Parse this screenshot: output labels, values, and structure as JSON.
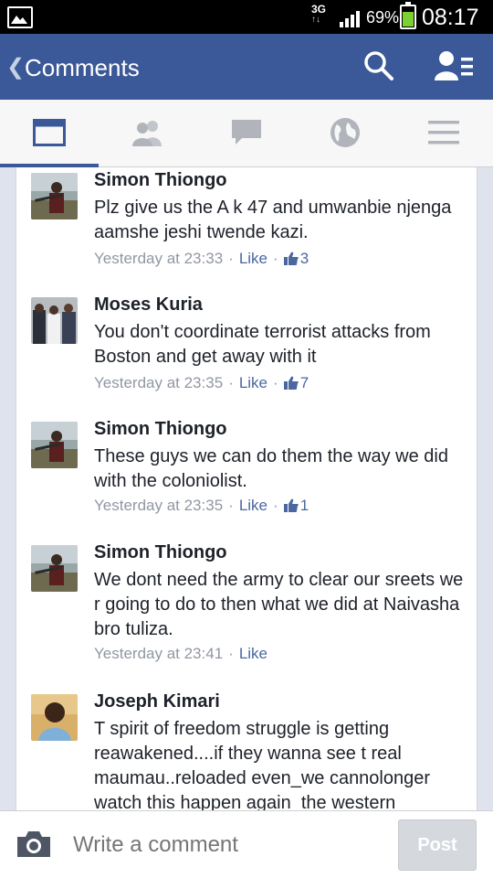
{
  "status_bar": {
    "network": "3G",
    "arrows": "↑↓",
    "battery": "69%",
    "battery_level": 0.69,
    "time": "08:17"
  },
  "header": {
    "title": "Comments"
  },
  "tabs": [
    {
      "icon": "news-feed-icon",
      "active": true
    },
    {
      "icon": "friends-icon",
      "active": false
    },
    {
      "icon": "messages-icon",
      "active": false
    },
    {
      "icon": "globe-icon",
      "active": false
    },
    {
      "icon": "menu-icon",
      "active": false
    }
  ],
  "comments": [
    {
      "author": "Simon Thiongo",
      "text": "Plz give us the A k 47 and umwanbie njenga aamshe jeshi twende kazi.",
      "time": "Yesterday at 23:33",
      "like_label": "Like",
      "likes": "3"
    },
    {
      "author": "Moses Kuria",
      "text": "You don't coordinate terrorist attacks from Boston and get away with it",
      "time": "Yesterday at 23:35",
      "like_label": "Like",
      "likes": "7"
    },
    {
      "author": "Simon Thiongo",
      "text": "These guys we can do them the way we did with the coloniolist.",
      "time": "Yesterday at 23:35",
      "like_label": "Like",
      "likes": "1"
    },
    {
      "author": "Simon Thiongo",
      "text": "We dont need the army to clear our sreets we r going to do to then  what we did at Naivasha bro tuliza.",
      "time": "Yesterday at 23:41",
      "like_label": "Like",
      "likes": ""
    },
    {
      "author": "Joseph Kimari",
      "text": "T spirit of freedom struggle is getting reawakened....if they wanna see t real maumau..reloaded even_we cannolonger watch this happen again_the western",
      "time": "",
      "like_label": "",
      "likes": ""
    }
  ],
  "composer": {
    "placeholder": "Write a comment",
    "post_label": "Post"
  },
  "colors": {
    "brand": "#3b5998",
    "link": "#4b67a1",
    "meta": "#9197a3"
  }
}
